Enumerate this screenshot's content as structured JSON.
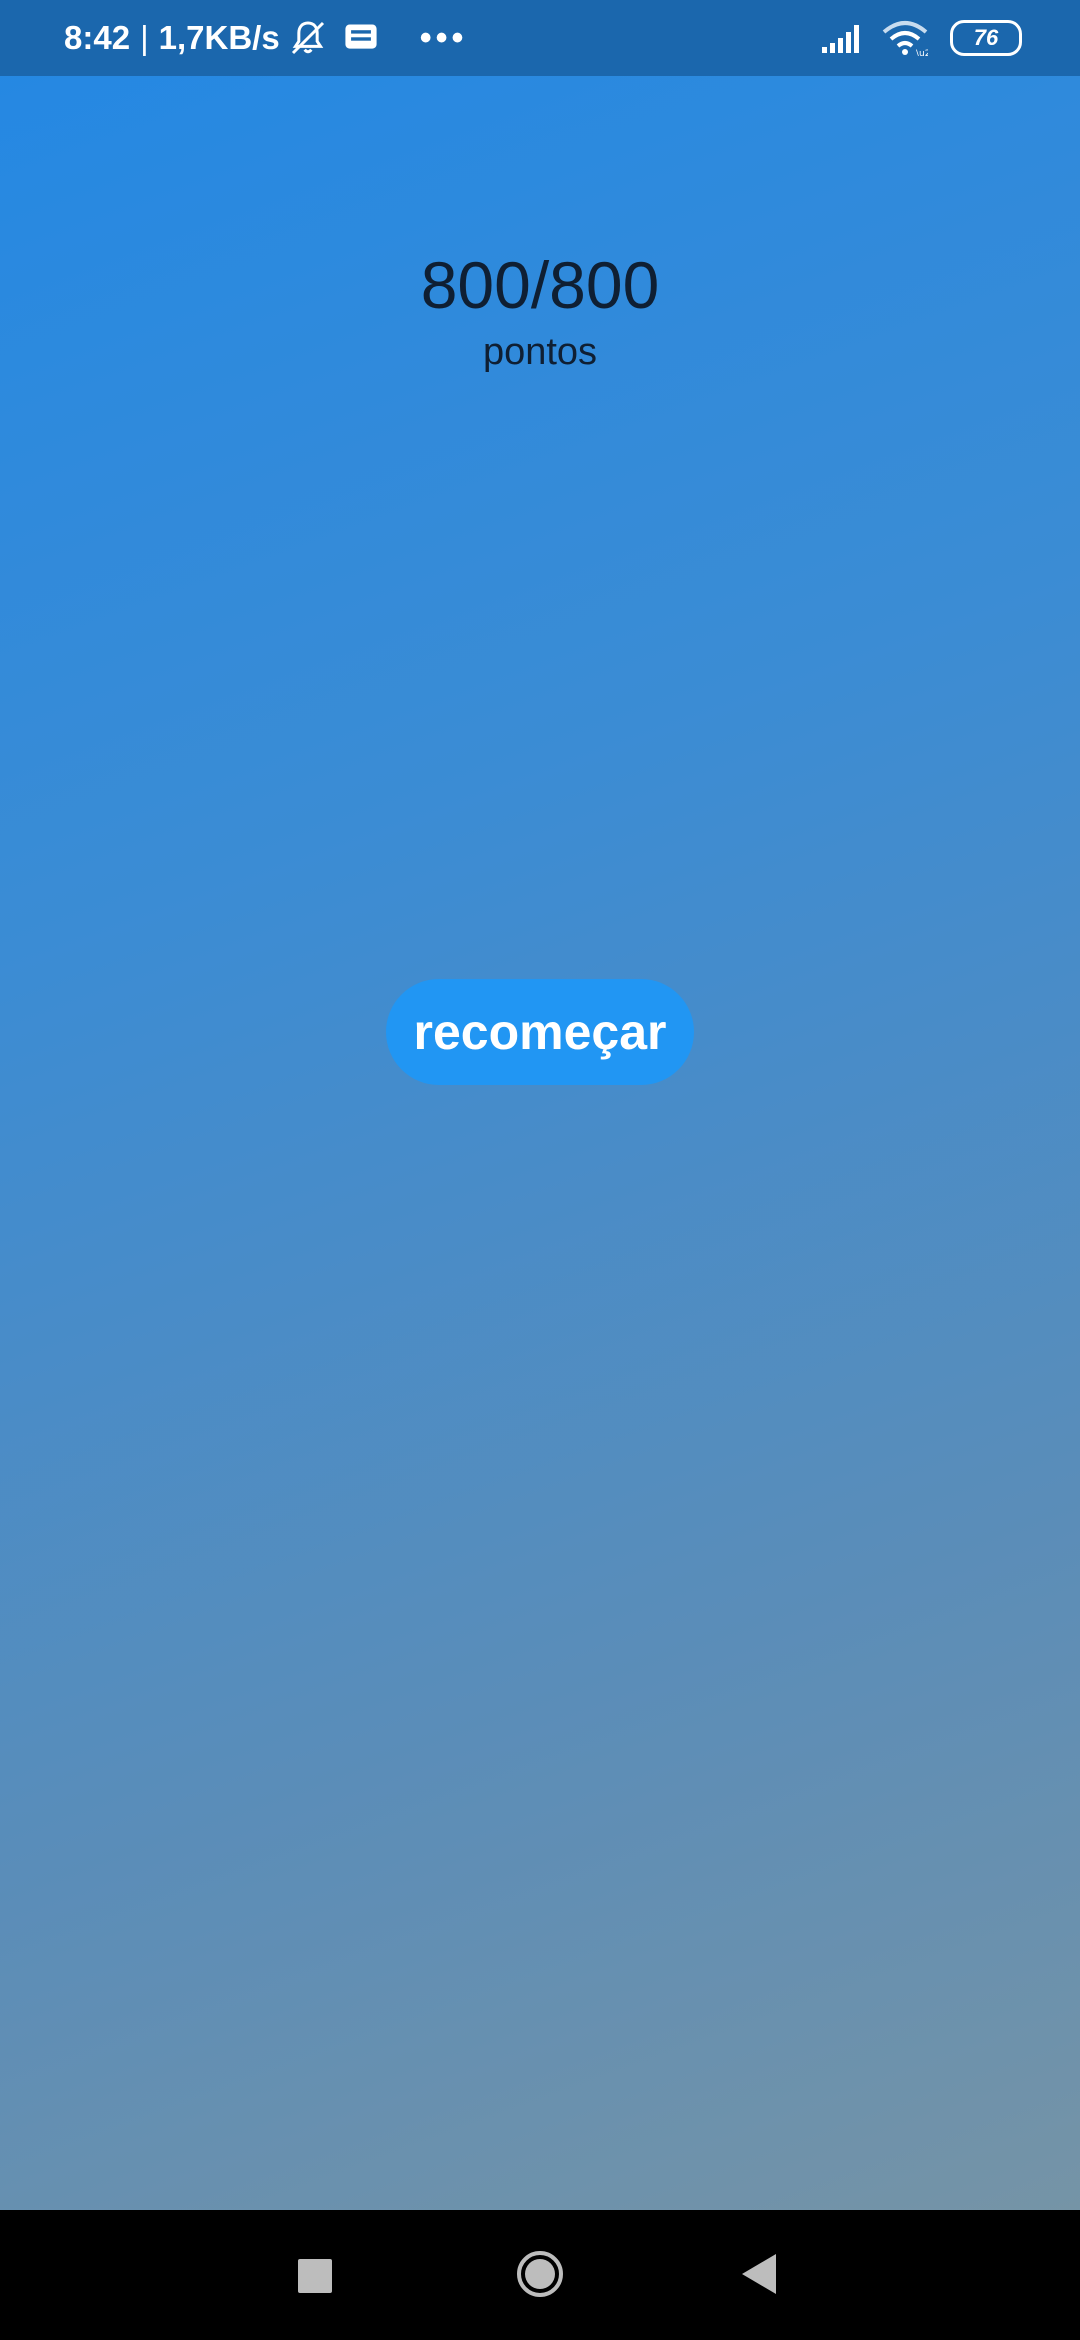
{
  "status_bar": {
    "time": "8:42",
    "separator": "|",
    "network_speed": "1,7KB/s",
    "more_indicator": "•••",
    "battery_level": "76",
    "icons": [
      "notifications-muted-icon",
      "message-icon",
      "signal-icon",
      "wifi-icon",
      "battery-icon"
    ]
  },
  "score": {
    "value": "800/800",
    "label": "pontos"
  },
  "restart_button": {
    "label": "recomeçar"
  },
  "nav_bar": {
    "icons": [
      "recent-apps-icon",
      "home-icon",
      "back-icon"
    ]
  },
  "colors": {
    "status_bar": "#1b67ad",
    "button": "#2196f3",
    "background_top": "#2388e4",
    "background_bottom": "#7a95a3"
  }
}
